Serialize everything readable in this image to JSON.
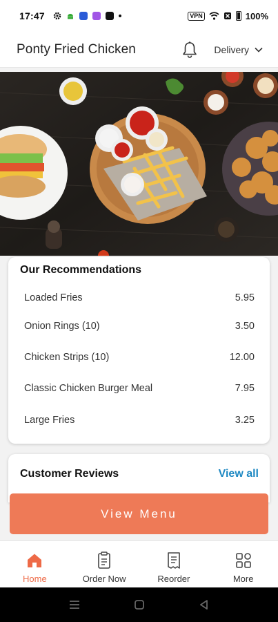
{
  "status_bar": {
    "time": "17:47",
    "vpn": "VPN",
    "battery": "100%"
  },
  "header": {
    "title": "Ponty Fried Chicken",
    "order_mode": "Delivery"
  },
  "recommendations": {
    "title": "Our Recommendations",
    "items": [
      {
        "name": "Loaded Fries",
        "price": "5.95"
      },
      {
        "name": "Onion Rings (10)",
        "price": "3.50"
      },
      {
        "name": "Chicken Strips (10)",
        "price": "12.00"
      },
      {
        "name": "Classic Chicken Burger Meal",
        "price": "7.95"
      },
      {
        "name": "Large Fries",
        "price": "3.25"
      }
    ]
  },
  "reviews": {
    "title": "Customer Reviews",
    "view_all": "View all"
  },
  "cta": {
    "label": "View Menu"
  },
  "bottom_nav": {
    "items": [
      {
        "label": "Home",
        "icon": "home-icon",
        "active": true
      },
      {
        "label": "Order Now",
        "icon": "order-icon",
        "active": false
      },
      {
        "label": "Reorder",
        "icon": "receipt-icon",
        "active": false
      },
      {
        "label": "More",
        "icon": "grid-icon",
        "active": false
      }
    ]
  },
  "colors": {
    "accent": "#ee7a57",
    "link": "#1d88c2",
    "active_nav": "#ee6a47"
  }
}
